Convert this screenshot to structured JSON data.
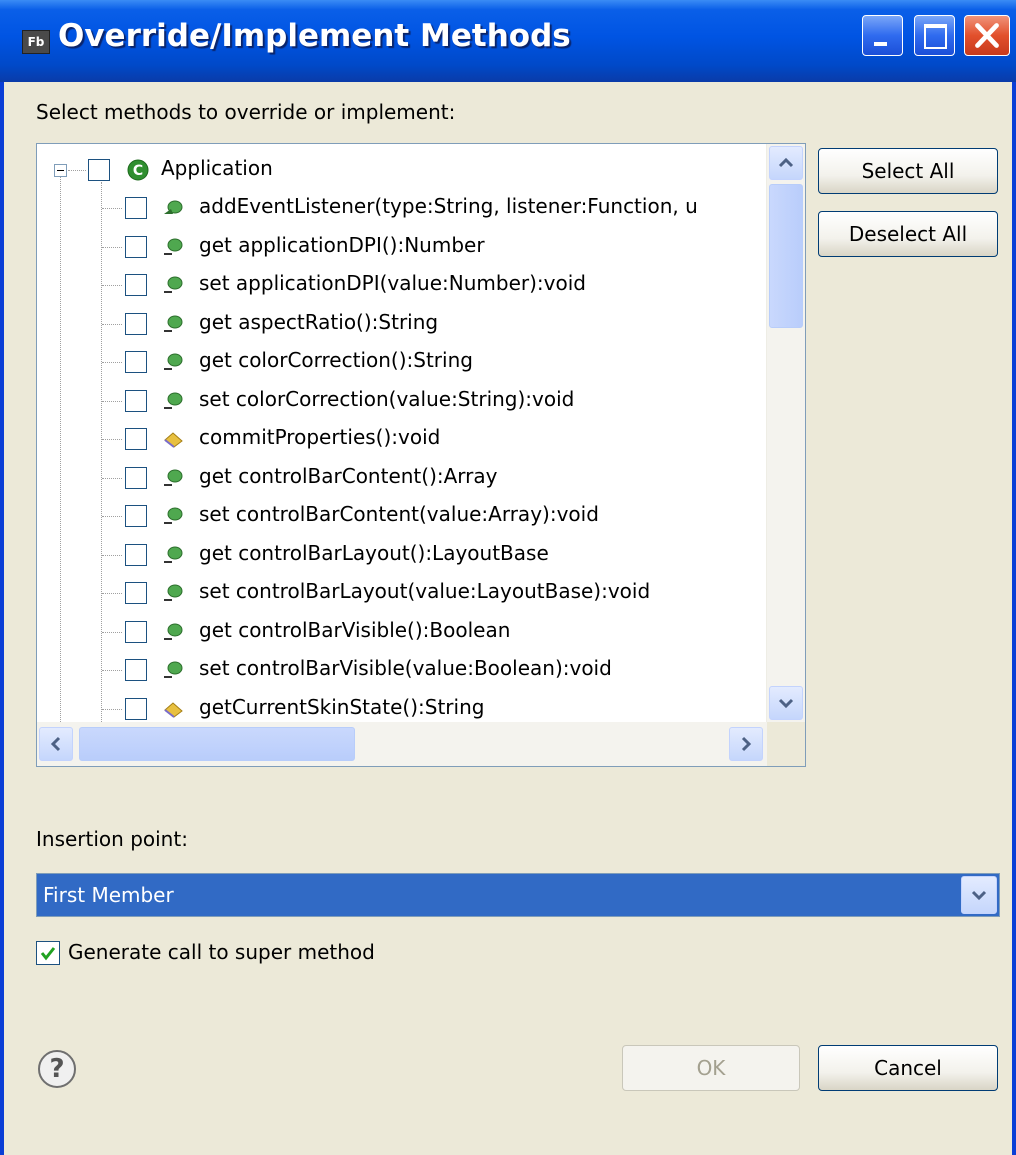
{
  "window": {
    "title": "Override/Implement Methods",
    "app_icon": "Fb"
  },
  "prompt": "Select methods to override or implement:",
  "tree": {
    "root": {
      "label": "Application",
      "icon": "class-icon",
      "checked": false,
      "expanded": true
    },
    "items": [
      {
        "label": "addEventListener(type:String, listener:Function, u",
        "icon": "public-method-icon",
        "checked": false
      },
      {
        "label": "get applicationDPI():Number",
        "icon": "getter-icon",
        "checked": false
      },
      {
        "label": "set applicationDPI(value:Number):void",
        "icon": "setter-icon",
        "checked": false
      },
      {
        "label": "get aspectRatio():String",
        "icon": "getter-icon",
        "checked": false
      },
      {
        "label": "get colorCorrection():String",
        "icon": "getter-icon",
        "checked": false
      },
      {
        "label": "set colorCorrection(value:String):void",
        "icon": "setter-icon",
        "checked": false
      },
      {
        "label": "commitProperties():void",
        "icon": "protected-method-icon",
        "checked": false
      },
      {
        "label": "get controlBarContent():Array",
        "icon": "getter-icon",
        "checked": false
      },
      {
        "label": "set controlBarContent(value:Array):void",
        "icon": "setter-icon",
        "checked": false
      },
      {
        "label": "get controlBarLayout():LayoutBase",
        "icon": "getter-icon",
        "checked": false
      },
      {
        "label": "set controlBarLayout(value:LayoutBase):void",
        "icon": "setter-icon",
        "checked": false
      },
      {
        "label": "get controlBarVisible():Boolean",
        "icon": "getter-icon",
        "checked": false
      },
      {
        "label": "set controlBarVisible(value:Boolean):void",
        "icon": "setter-icon",
        "checked": false
      },
      {
        "label": "getCurrentSkinState():String",
        "icon": "protected-method-icon",
        "checked": false
      }
    ]
  },
  "buttons": {
    "select_all": "Select All",
    "deselect_all": "Deselect All",
    "ok": "OK",
    "cancel": "Cancel"
  },
  "insertion": {
    "label": "Insertion point:",
    "selected": "First Member"
  },
  "generate_super": {
    "label": "Generate call to super method",
    "checked": true
  },
  "colors": {
    "titlebar": "#0054e3",
    "dialog_bg": "#ece9d8",
    "selection": "#316ac5",
    "method_green": "#3c9a3c",
    "protected_yellow": "#e8c040"
  }
}
